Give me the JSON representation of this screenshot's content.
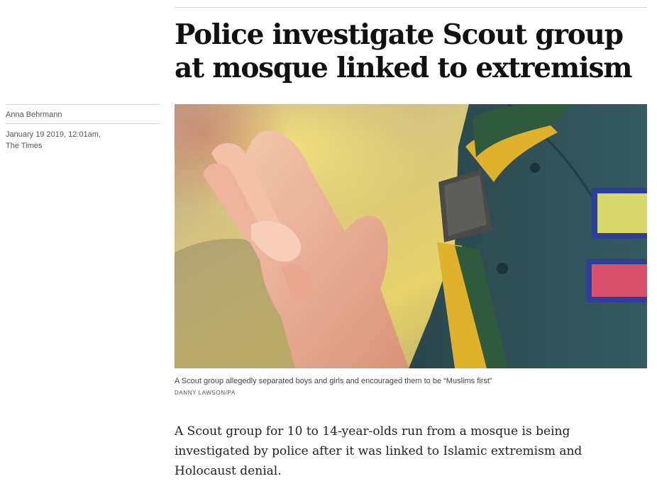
{
  "article": {
    "headline": "Police investigate Scout group at mosque linked to extremism",
    "author": "Anna Behrmann",
    "date": "January 19 2019, 12:01am,",
    "publication": "The Times",
    "image": {
      "caption": "A Scout group allegedly separated boys and girls and encouraged them to be “Muslims first”",
      "credit": "DANNY LAWSON/PA"
    },
    "lead_paragraph": "A Scout group for 10 to 14-year-olds run from a mosque is being investigated by police after it was linked to Islamic extremism and Holocaust denial."
  },
  "colors": {
    "scarf_yellow": "#e0b12a",
    "scarf_green": "#2f5a3d",
    "shirt": "#2f4f55",
    "skin": "#f0b8a0"
  }
}
